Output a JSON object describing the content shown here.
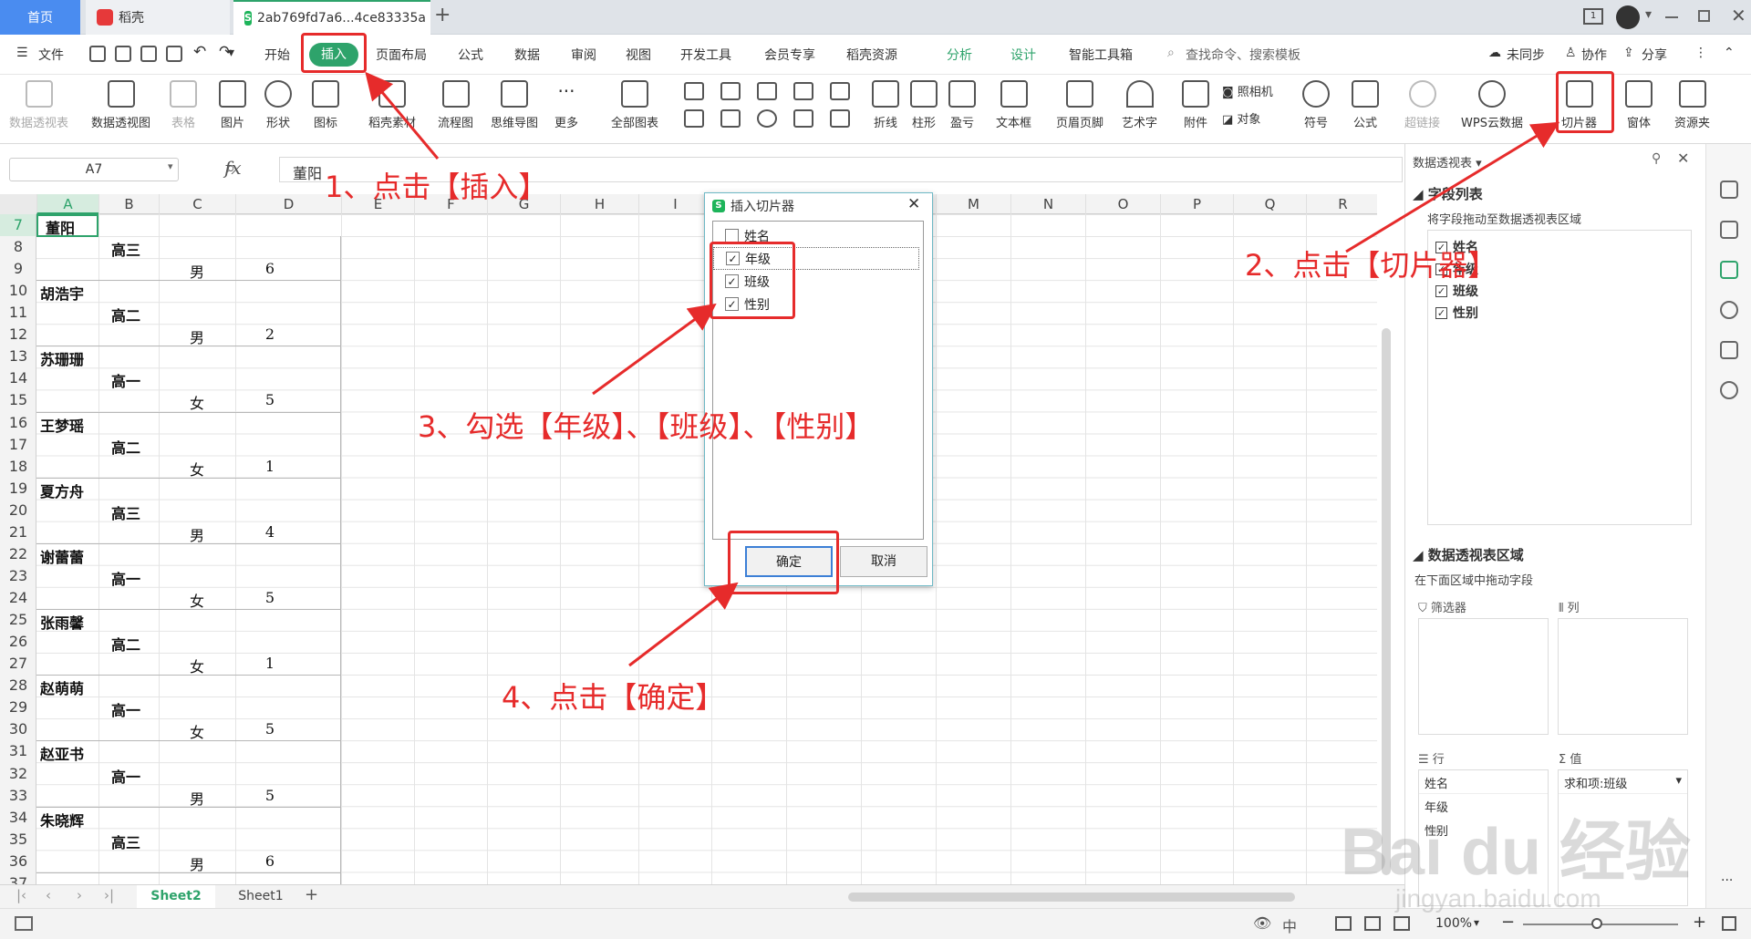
{
  "tabs": {
    "home": "首页",
    "docer": "稻壳",
    "file": "2ab769fd7a6...4ce83335a",
    "add": "+"
  },
  "window": {
    "page_indicator": "1"
  },
  "menu": {
    "file": "文件",
    "items": [
      "开始",
      "插入",
      "页面布局",
      "公式",
      "数据",
      "审阅",
      "视图",
      "开发工具",
      "会员专享",
      "稻壳资源",
      "分析",
      "设计",
      "智能工具箱"
    ],
    "search": "查找命令、搜索模板",
    "sync": "未同步",
    "collab": "协作",
    "share": "分享"
  },
  "ribbon": {
    "items": [
      "数据透视表",
      "数据透视图",
      "表格",
      "图片",
      "形状",
      "图标",
      "稻壳素材",
      "流程图",
      "思维导图",
      "更多",
      "全部图表",
      "折线",
      "柱形",
      "盈亏",
      "文本框",
      "页眉页脚",
      "艺术字",
      "附件",
      "照相机",
      "对象",
      "符号",
      "公式",
      "超链接",
      "WPS云数据",
      "切片器",
      "窗体",
      "资源夹"
    ]
  },
  "formula": {
    "cell_ref": "A7",
    "fx": "fx",
    "value": "董阳"
  },
  "columns": [
    "A",
    "B",
    "C",
    "D",
    "E",
    "F",
    "G",
    "H",
    "I",
    "J",
    "K",
    "L",
    "M",
    "N",
    "O",
    "P",
    "Q",
    "R"
  ],
  "rows": [
    "7",
    "8",
    "9",
    "10",
    "11",
    "12",
    "13",
    "14",
    "15",
    "16",
    "17",
    "18",
    "19",
    "20",
    "21",
    "22",
    "23",
    "24",
    "25",
    "26",
    "27",
    "28",
    "29",
    "30",
    "31",
    "32",
    "33",
    "34",
    "35",
    "36",
    "37"
  ],
  "cells": {
    "a7": "董阳",
    "names": [
      "胡浩宇",
      "苏珊珊",
      "王梦瑶",
      "夏方舟",
      "谢蕾蕾",
      "张雨馨",
      "赵萌萌",
      "赵亚书",
      "朱晓辉"
    ],
    "grades": [
      "高三",
      "高二",
      "高一",
      "高二",
      "高三",
      "高一",
      "高二",
      "高一",
      "高一",
      "高三"
    ],
    "genders": [
      "男",
      "男",
      "女",
      "女",
      "男",
      "女",
      "女",
      "女",
      "男",
      "男"
    ],
    "nums": [
      "6",
      "2",
      "5",
      "1",
      "4",
      "5",
      "1",
      "5",
      "5",
      "6"
    ]
  },
  "sheets": {
    "active": "Sheet2",
    "other": "Sheet1",
    "add": "+"
  },
  "status": {
    "zoom": "100%",
    "zoom_arrow": "▾"
  },
  "panel": {
    "title": "数据透视表",
    "field_list": "字段列表",
    "field_hint": "将字段拖动至数据透视表区域",
    "fields": [
      "姓名",
      "年级",
      "班级",
      "性别"
    ],
    "area_title": "数据透视表区域",
    "area_hint": "在下面区域中拖动字段",
    "filter": "筛选器",
    "col": "列",
    "row": "行",
    "val": "值",
    "row_items": [
      "姓名",
      "年级",
      "性别"
    ],
    "val_item": "求和项:班级"
  },
  "dialog": {
    "title": "插入切片器",
    "items": [
      {
        "label": "姓名",
        "checked": false
      },
      {
        "label": "年级",
        "checked": true
      },
      {
        "label": "班级",
        "checked": true
      },
      {
        "label": "性别",
        "checked": true
      }
    ],
    "ok": "确定",
    "cancel": "取消"
  },
  "annotations": {
    "step1": "1、点击【插入】",
    "step2": "2、点击【切片器】",
    "step3": "3、勾选【年级】、【班级】、【性别】",
    "step4": "4、点击【确定】"
  },
  "watermark": {
    "brand": "Bai du 经验",
    "url": "jingyan.baidu.com"
  },
  "colors": {
    "accent_green": "#2ea36b",
    "annotation_red": "#e62b2b",
    "home_tab": "#4a8cf0"
  }
}
